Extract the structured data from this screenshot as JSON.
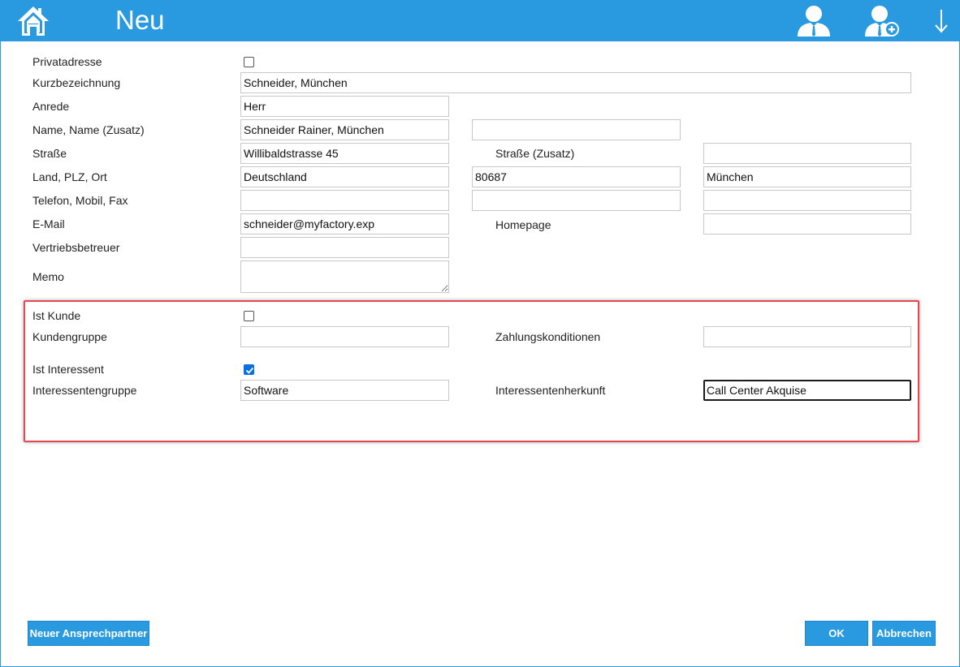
{
  "header": {
    "title": "Neu",
    "icons": [
      "home-icon",
      "user-icon",
      "user-add-icon",
      "arrow-down-icon"
    ],
    "color": "#2a9ae0"
  },
  "form": {
    "privatadresse": {
      "label": "Privatadresse",
      "checked": false
    },
    "kurzbezeichnung": {
      "label": "Kurzbezeichnung",
      "value": "Schneider, München"
    },
    "anrede": {
      "label": "Anrede",
      "value": "Herr"
    },
    "name": {
      "label": "Name, Name (Zusatz)",
      "value": "Schneider Rainer, München",
      "value2": ""
    },
    "strasse": {
      "label": "Straße",
      "value": "Willibaldstrasse 45",
      "label2": "Straße (Zusatz)",
      "value2": ""
    },
    "land": {
      "label": "Land, PLZ, Ort",
      "country": "Deutschland",
      "zip": "80687",
      "city": "München"
    },
    "telefon": {
      "label": "Telefon, Mobil, Fax",
      "phone": "",
      "mobile": "",
      "fax": ""
    },
    "email": {
      "label": "E-Mail",
      "value": "schneider@myfactory.exp",
      "label2": "Homepage",
      "value2": ""
    },
    "vertrieb": {
      "label": "Vertriebsbetreuer",
      "value": ""
    },
    "memo": {
      "label": "Memo",
      "value": ""
    }
  },
  "section": {
    "highlight_color": "#e8474f",
    "ist_kunde": {
      "label": "Ist Kunde",
      "checked": false
    },
    "kundengruppe": {
      "label": "Kundengruppe",
      "value": "",
      "label2": "Zahlungskonditionen",
      "value2": ""
    },
    "ist_interessent": {
      "label": "Ist Interessent",
      "checked": true
    },
    "interessentengruppe": {
      "label": "Interessentengruppe",
      "value": "Software",
      "label2": "Interessentenherkunft",
      "value2": "Call Center Akquise"
    }
  },
  "footer": {
    "new_contact": "Neuer Ansprechpartner",
    "ok": "OK",
    "cancel": "Abbrechen"
  }
}
